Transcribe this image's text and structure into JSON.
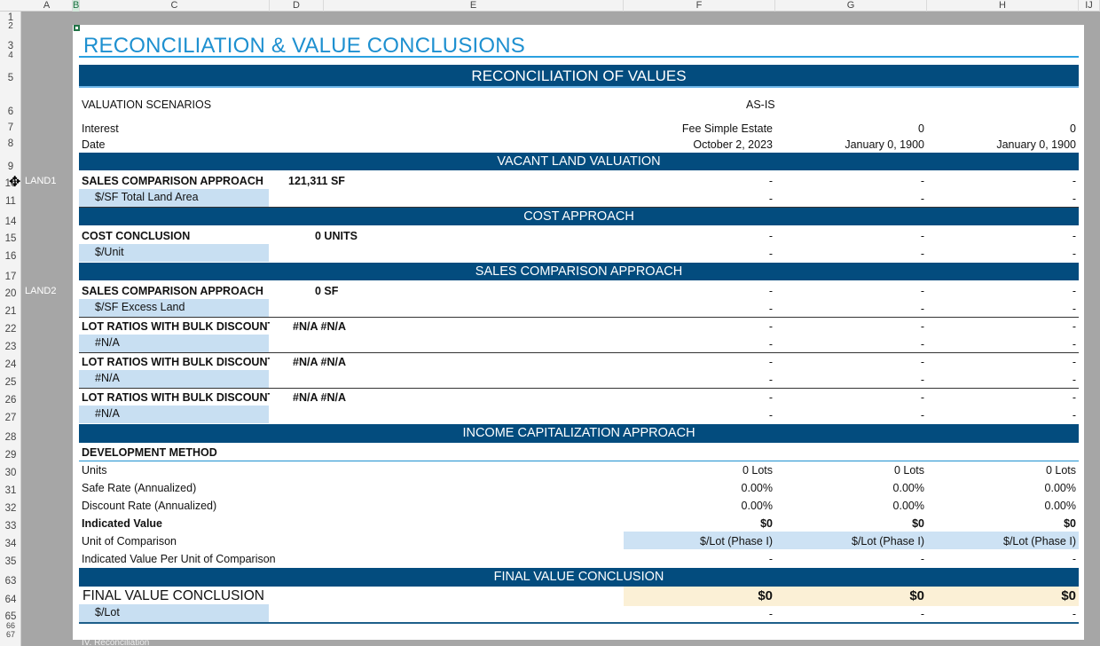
{
  "column_headers": [
    "A",
    "B",
    "C",
    "D",
    "E",
    "F",
    "G",
    "H",
    "IJ"
  ],
  "row_numbers": [
    "1",
    "2",
    "3",
    "4",
    "5",
    "6",
    "7",
    "8",
    "9",
    "10",
    "11",
    "14",
    "15",
    "16",
    "17",
    "20",
    "21",
    "22",
    "23",
    "24",
    "25",
    "26",
    "27",
    "28",
    "29",
    "30",
    "31",
    "32",
    "33",
    "34",
    "35",
    "63",
    "64",
    "65",
    "66",
    "67"
  ],
  "row_side_labels": {
    "land1": "LAND1",
    "land2": "LAND2"
  },
  "sheet_tab_partial": "IV. Reconciliation",
  "title": "RECONCILIATION & VALUE CONCLUSIONS",
  "main_band": "RECONCILIATION OF VALUES",
  "scenarios": {
    "label": "VALUATION SCENARIOS",
    "as_is": "AS-IS",
    "interest_label": "Interest",
    "interest_values": [
      "Fee Simple Estate",
      "0",
      "0"
    ],
    "date_label": "Date",
    "date_values": [
      "October 2, 2023",
      "January 0, 1900",
      "January 0, 1900"
    ]
  },
  "vacant_land": {
    "band": "VACANT LAND VALUATION",
    "approach_label": "SALES COMPARISON APPROACH",
    "approach_qty": "121,311 SF",
    "sub_label": "$/SF Total Land Area",
    "dash": "-"
  },
  "cost": {
    "band": "COST APPROACH",
    "label": "COST CONCLUSION",
    "qty": "0 UNITS",
    "sub_label": "$/Unit"
  },
  "sales": {
    "band": "SALES COMPARISON APPROACH",
    "label": "SALES COMPARISON APPROACH",
    "qty": "0 SF",
    "sub_label": "$/SF Excess Land",
    "lot_label": "LOT RATIOS WITH BULK DISCOUNT",
    "lot_qty": "#N/A #N/A",
    "lot_sub": "#N/A"
  },
  "income": {
    "band": "INCOME CAPITALIZATION APPROACH",
    "method": "DEVELOPMENT METHOD",
    "units_label": "Units",
    "units_values": [
      "0 Lots",
      "0 Lots",
      "0 Lots"
    ],
    "safe_label": "Safe Rate (Annualized)",
    "safe_values": [
      "0.00%",
      "0.00%",
      "0.00%"
    ],
    "discount_label": "Discount Rate (Annualized)",
    "discount_values": [
      "0.00%",
      "0.00%",
      "0.00%"
    ],
    "indicated_label": "Indicated Value",
    "indicated_values": [
      "$0",
      "$0",
      "$0"
    ],
    "uoc_label": "Unit of Comparison",
    "uoc_values": [
      "$/Lot (Phase I)",
      "$/Lot (Phase I)",
      "$/Lot (Phase I)"
    ],
    "ivpu_label": "Indicated Value Per Unit of Comparison"
  },
  "final": {
    "band": "FINAL VALUE CONCLUSION",
    "label": "FINAL VALUE CONCLUSION",
    "values": [
      "$0",
      "$0",
      "$0"
    ],
    "sub_label": "$/Lot"
  },
  "colors": {
    "band": "#034c7e",
    "title": "#1e90d0",
    "light_blue": "#c8dff2",
    "cream": "#fbf0d6"
  }
}
